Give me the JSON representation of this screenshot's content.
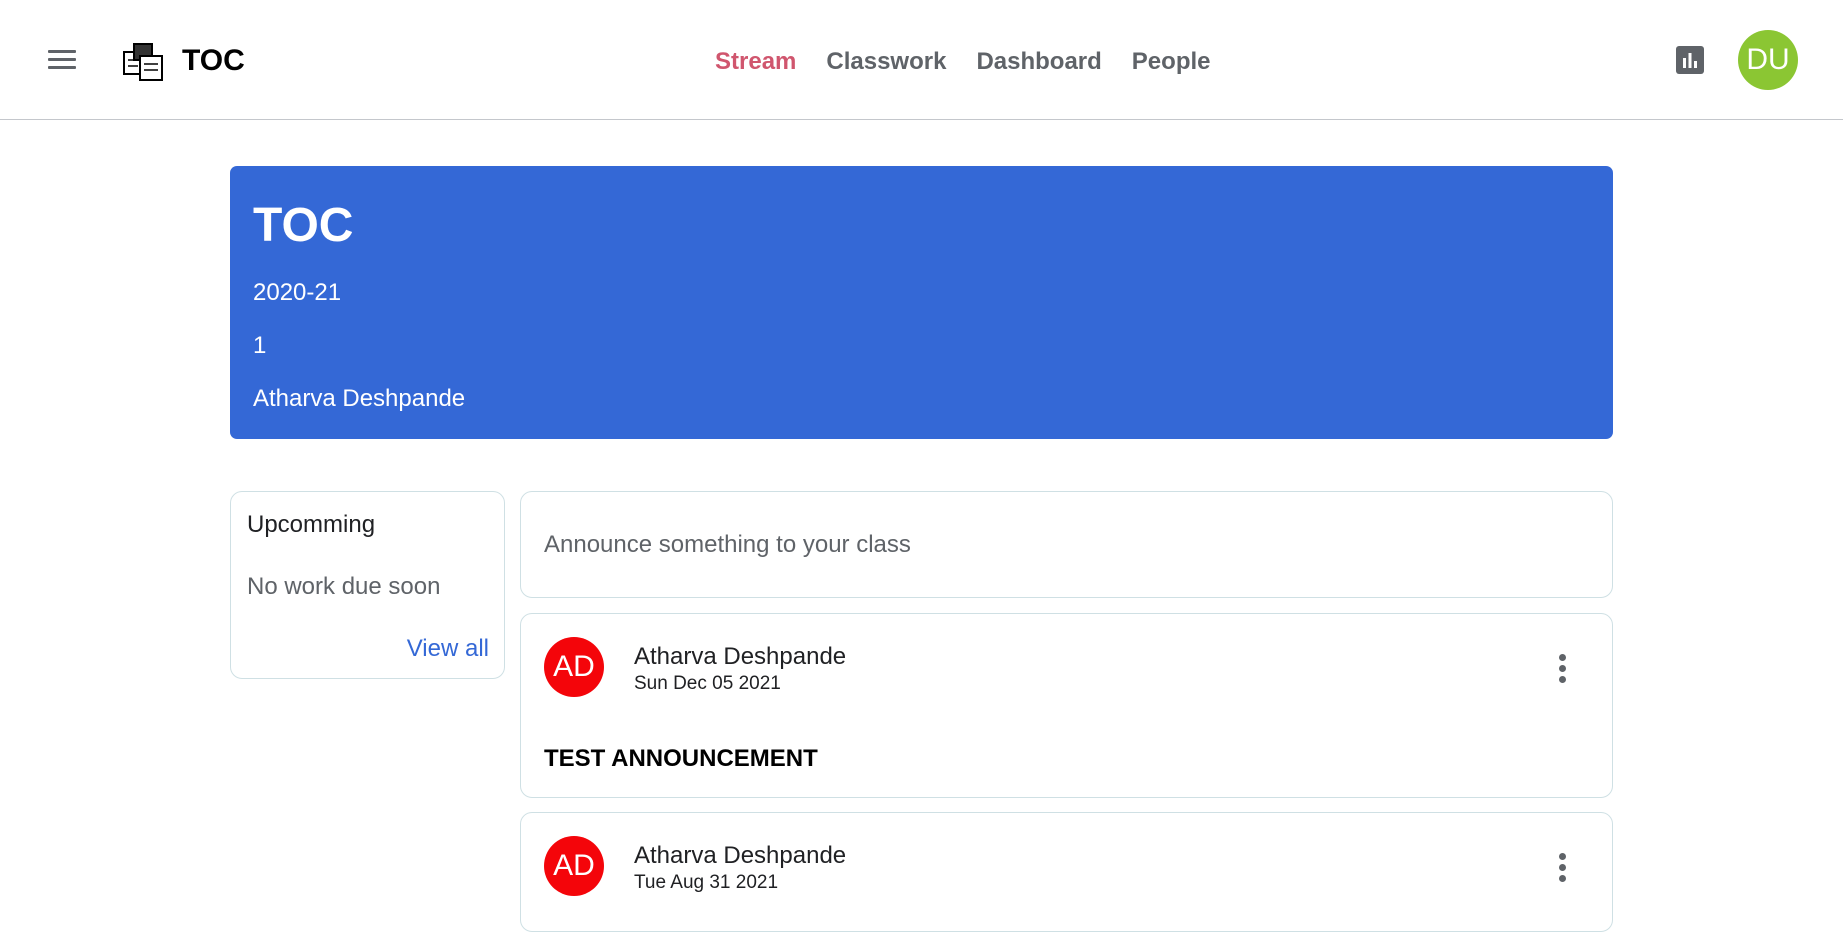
{
  "header": {
    "app_title": "TOC",
    "tabs": [
      {
        "label": "Stream",
        "active": true
      },
      {
        "label": "Classwork",
        "active": false
      },
      {
        "label": "Dashboard",
        "active": false
      },
      {
        "label": "People",
        "active": false
      }
    ],
    "user_initials": "DU",
    "icons": [
      "menu-icon",
      "classroom-logo-icon",
      "bar-chart-icon"
    ]
  },
  "banner": {
    "title": "TOC",
    "session": "2020-21",
    "section": "1",
    "teacher": "Atharva Deshpande"
  },
  "upcoming": {
    "title": "Upcomming",
    "empty_text": "No work due soon",
    "view_all": "View all"
  },
  "announce": {
    "placeholder": "Announce something to your class"
  },
  "posts": [
    {
      "initials": "AD",
      "author": "Atharva Deshpande",
      "date": "Sun Dec 05 2021",
      "body": "TEST ANNOUNCEMENT"
    },
    {
      "initials": "AD",
      "author": "Atharva Deshpande",
      "date": "Tue Aug 31 2021"
    }
  ],
  "colors": {
    "banner": "#3468d6",
    "active_tab": "#d0566e",
    "user_avatar": "#8bc633",
    "post_avatar": "#f4050a",
    "link": "#3468d6"
  }
}
